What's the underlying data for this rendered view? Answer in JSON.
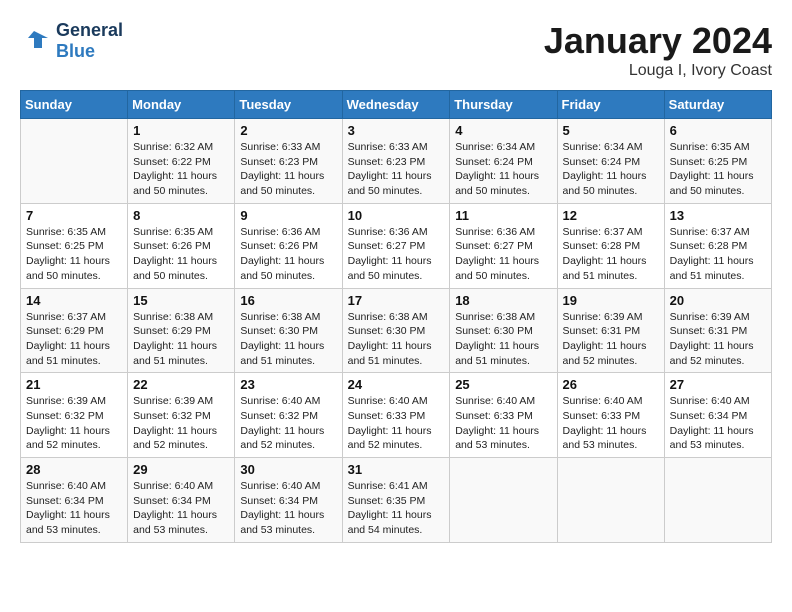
{
  "header": {
    "logo_line1": "General",
    "logo_line2": "Blue",
    "title": "January 2024",
    "subtitle": "Louga I, Ivory Coast"
  },
  "days_of_week": [
    "Sunday",
    "Monday",
    "Tuesday",
    "Wednesday",
    "Thursday",
    "Friday",
    "Saturday"
  ],
  "weeks": [
    [
      {
        "num": "",
        "info": ""
      },
      {
        "num": "1",
        "info": "Sunrise: 6:32 AM\nSunset: 6:22 PM\nDaylight: 11 hours\nand 50 minutes."
      },
      {
        "num": "2",
        "info": "Sunrise: 6:33 AM\nSunset: 6:23 PM\nDaylight: 11 hours\nand 50 minutes."
      },
      {
        "num": "3",
        "info": "Sunrise: 6:33 AM\nSunset: 6:23 PM\nDaylight: 11 hours\nand 50 minutes."
      },
      {
        "num": "4",
        "info": "Sunrise: 6:34 AM\nSunset: 6:24 PM\nDaylight: 11 hours\nand 50 minutes."
      },
      {
        "num": "5",
        "info": "Sunrise: 6:34 AM\nSunset: 6:24 PM\nDaylight: 11 hours\nand 50 minutes."
      },
      {
        "num": "6",
        "info": "Sunrise: 6:35 AM\nSunset: 6:25 PM\nDaylight: 11 hours\nand 50 minutes."
      }
    ],
    [
      {
        "num": "7",
        "info": "Sunrise: 6:35 AM\nSunset: 6:25 PM\nDaylight: 11 hours\nand 50 minutes."
      },
      {
        "num": "8",
        "info": "Sunrise: 6:35 AM\nSunset: 6:26 PM\nDaylight: 11 hours\nand 50 minutes."
      },
      {
        "num": "9",
        "info": "Sunrise: 6:36 AM\nSunset: 6:26 PM\nDaylight: 11 hours\nand 50 minutes."
      },
      {
        "num": "10",
        "info": "Sunrise: 6:36 AM\nSunset: 6:27 PM\nDaylight: 11 hours\nand 50 minutes."
      },
      {
        "num": "11",
        "info": "Sunrise: 6:36 AM\nSunset: 6:27 PM\nDaylight: 11 hours\nand 50 minutes."
      },
      {
        "num": "12",
        "info": "Sunrise: 6:37 AM\nSunset: 6:28 PM\nDaylight: 11 hours\nand 51 minutes."
      },
      {
        "num": "13",
        "info": "Sunrise: 6:37 AM\nSunset: 6:28 PM\nDaylight: 11 hours\nand 51 minutes."
      }
    ],
    [
      {
        "num": "14",
        "info": "Sunrise: 6:37 AM\nSunset: 6:29 PM\nDaylight: 11 hours\nand 51 minutes."
      },
      {
        "num": "15",
        "info": "Sunrise: 6:38 AM\nSunset: 6:29 PM\nDaylight: 11 hours\nand 51 minutes."
      },
      {
        "num": "16",
        "info": "Sunrise: 6:38 AM\nSunset: 6:30 PM\nDaylight: 11 hours\nand 51 minutes."
      },
      {
        "num": "17",
        "info": "Sunrise: 6:38 AM\nSunset: 6:30 PM\nDaylight: 11 hours\nand 51 minutes."
      },
      {
        "num": "18",
        "info": "Sunrise: 6:38 AM\nSunset: 6:30 PM\nDaylight: 11 hours\nand 51 minutes."
      },
      {
        "num": "19",
        "info": "Sunrise: 6:39 AM\nSunset: 6:31 PM\nDaylight: 11 hours\nand 52 minutes."
      },
      {
        "num": "20",
        "info": "Sunrise: 6:39 AM\nSunset: 6:31 PM\nDaylight: 11 hours\nand 52 minutes."
      }
    ],
    [
      {
        "num": "21",
        "info": "Sunrise: 6:39 AM\nSunset: 6:32 PM\nDaylight: 11 hours\nand 52 minutes."
      },
      {
        "num": "22",
        "info": "Sunrise: 6:39 AM\nSunset: 6:32 PM\nDaylight: 11 hours\nand 52 minutes."
      },
      {
        "num": "23",
        "info": "Sunrise: 6:40 AM\nSunset: 6:32 PM\nDaylight: 11 hours\nand 52 minutes."
      },
      {
        "num": "24",
        "info": "Sunrise: 6:40 AM\nSunset: 6:33 PM\nDaylight: 11 hours\nand 52 minutes."
      },
      {
        "num": "25",
        "info": "Sunrise: 6:40 AM\nSunset: 6:33 PM\nDaylight: 11 hours\nand 53 minutes."
      },
      {
        "num": "26",
        "info": "Sunrise: 6:40 AM\nSunset: 6:33 PM\nDaylight: 11 hours\nand 53 minutes."
      },
      {
        "num": "27",
        "info": "Sunrise: 6:40 AM\nSunset: 6:34 PM\nDaylight: 11 hours\nand 53 minutes."
      }
    ],
    [
      {
        "num": "28",
        "info": "Sunrise: 6:40 AM\nSunset: 6:34 PM\nDaylight: 11 hours\nand 53 minutes."
      },
      {
        "num": "29",
        "info": "Sunrise: 6:40 AM\nSunset: 6:34 PM\nDaylight: 11 hours\nand 53 minutes."
      },
      {
        "num": "30",
        "info": "Sunrise: 6:40 AM\nSunset: 6:34 PM\nDaylight: 11 hours\nand 53 minutes."
      },
      {
        "num": "31",
        "info": "Sunrise: 6:41 AM\nSunset: 6:35 PM\nDaylight: 11 hours\nand 54 minutes."
      },
      {
        "num": "",
        "info": ""
      },
      {
        "num": "",
        "info": ""
      },
      {
        "num": "",
        "info": ""
      }
    ]
  ]
}
